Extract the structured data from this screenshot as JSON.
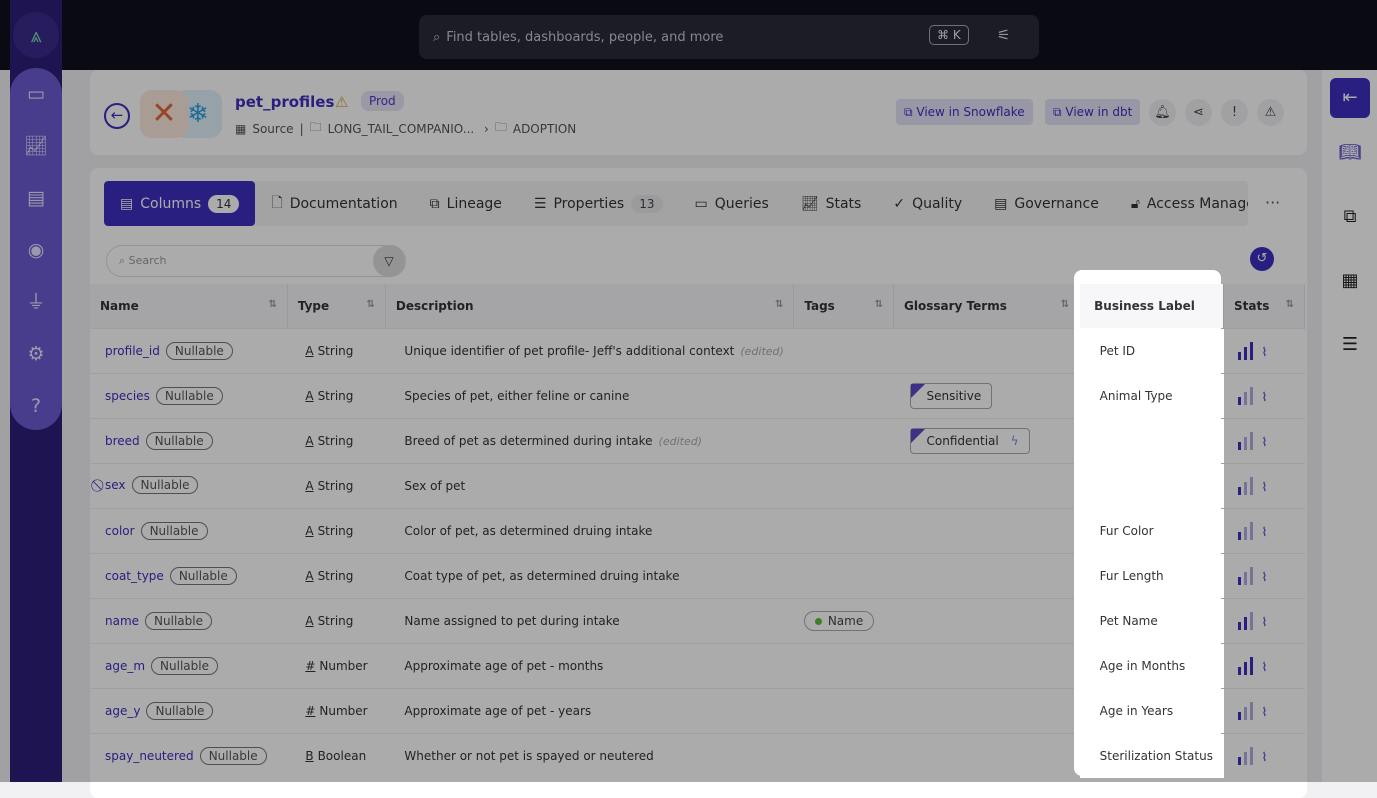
{
  "search": {
    "placeholder": "Find tables, dashboards, people, and more",
    "shortcut": "⌘ K"
  },
  "left_nav": {
    "items": [
      "inbox-icon",
      "insights-icon",
      "governance-icon",
      "observe-icon",
      "plug-icon",
      "settings-icon",
      "help-icon"
    ]
  },
  "asset": {
    "title": "pet_profiles",
    "env_badge": "Prod",
    "source_label": "Source",
    "path": [
      "LONG_TAIL_COMPANIO...",
      "ADOPTION"
    ],
    "view_snowflake": "View in Snowflake",
    "view_dbt": "View in dbt"
  },
  "tabs": [
    {
      "label": "Columns",
      "count": "14"
    },
    {
      "label": "Documentation"
    },
    {
      "label": "Lineage"
    },
    {
      "label": "Properties",
      "count": "13"
    },
    {
      "label": "Queries"
    },
    {
      "label": "Stats"
    },
    {
      "label": "Quality"
    },
    {
      "label": "Governance"
    },
    {
      "label": "Access Managemen"
    }
  ],
  "table_search": {
    "placeholder": "Search"
  },
  "columns": [
    "Name",
    "Type",
    "Description",
    "Tags",
    "Glossary Terms",
    "Business Label",
    "Stats"
  ],
  "nullable": "Nullable",
  "edited": "(edited)",
  "rows": [
    {
      "name": "profile_id",
      "type_icon": "A",
      "type": "String",
      "desc": "Unique identifier of pet profile- Jeff's additional context",
      "edited": true,
      "tag": "",
      "glossary": "",
      "label": "Pet ID",
      "stat": "high"
    },
    {
      "name": "species",
      "type_icon": "A",
      "type": "String",
      "desc": "Species of pet, either feline or canine",
      "tag": "",
      "glossary": "Sensitive",
      "label": "Animal Type",
      "stat": "low"
    },
    {
      "name": "breed",
      "type_icon": "A",
      "type": "String",
      "desc": "Breed of pet as determined during intake",
      "edited": true,
      "tag": "",
      "glossary": "Confidential",
      "label": "",
      "stat": "low"
    },
    {
      "name": "sex",
      "hidden": true,
      "type_icon": "A",
      "type": "String",
      "desc": "Sex of pet",
      "tag": "",
      "glossary": "",
      "label": "",
      "stat": "low"
    },
    {
      "name": "color",
      "type_icon": "A",
      "type": "String",
      "desc": "Color of pet, as determined druing intake",
      "tag": "",
      "glossary": "",
      "label": "Fur Color",
      "stat": "low"
    },
    {
      "name": "coat_type",
      "type_icon": "A",
      "type": "String",
      "desc": "Coat type of pet, as determined druing intake",
      "tag": "",
      "glossary": "",
      "label": "Fur Length",
      "stat": "low"
    },
    {
      "name": "name",
      "type_icon": "A",
      "type": "String",
      "desc": "Name assigned to pet during intake",
      "tag": "Name",
      "glossary": "",
      "label": "Pet Name",
      "stat": "mid"
    },
    {
      "name": "age_m",
      "type_icon": "#",
      "type": "Number",
      "desc": "Approximate age of pet - months",
      "tag": "",
      "glossary": "",
      "label": "Age in Months",
      "stat": "high"
    },
    {
      "name": "age_y",
      "type_icon": "#",
      "type": "Number",
      "desc": "Approximate age of pet - years",
      "tag": "",
      "glossary": "",
      "label": "Age in Years",
      "stat": "low"
    },
    {
      "name": "spay_neutered",
      "type_icon": "B",
      "type": "Boolean",
      "desc": "Whether or not pet is spayed or neutered",
      "tag": "",
      "glossary": "",
      "label": "Sterilization Status",
      "stat": "low"
    }
  ],
  "colors": {
    "accent": "#3c2fbf",
    "nav": "#6b5bd1",
    "overlay": "rgba(0,0,0,0.33)"
  }
}
